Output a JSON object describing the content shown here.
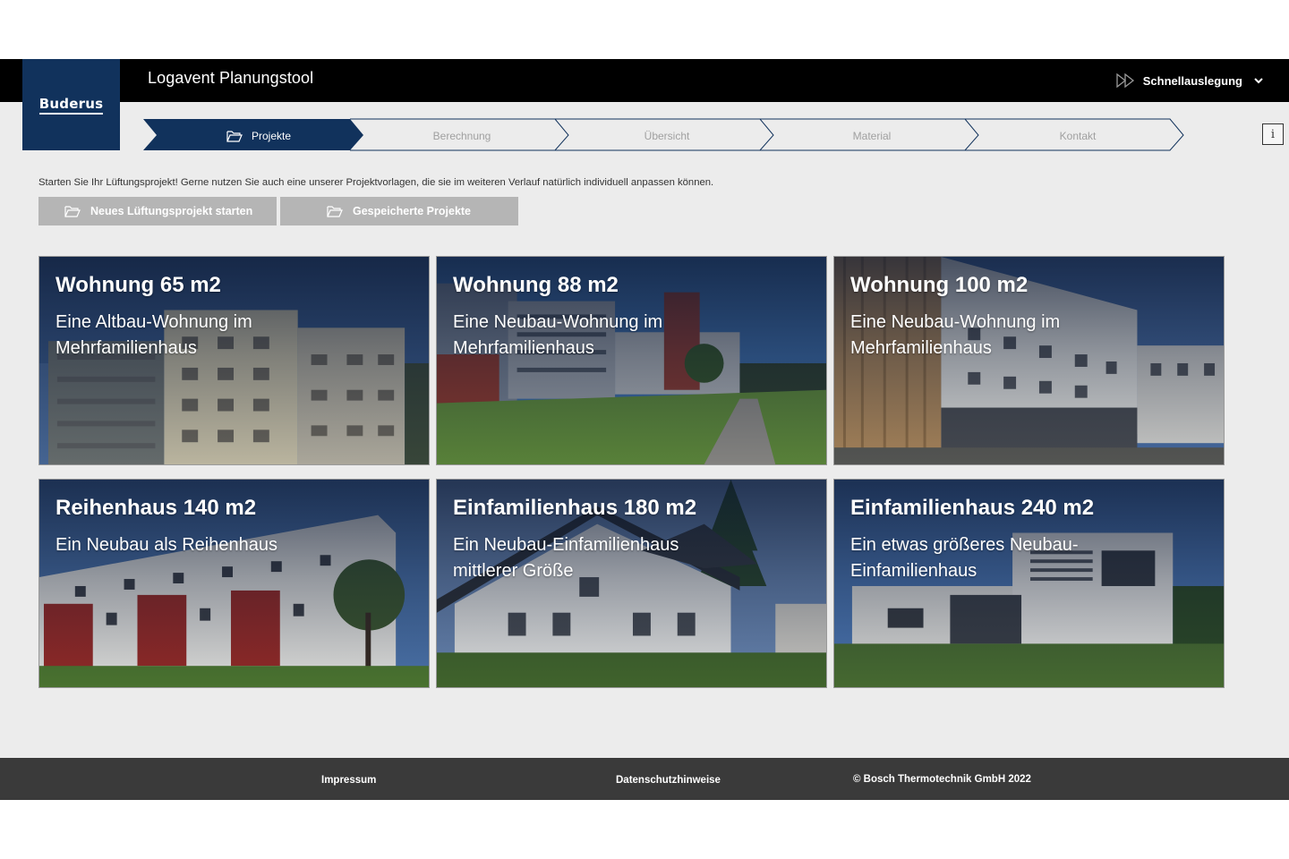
{
  "brand": {
    "logo_text": "Buderus",
    "primary": "#11325c"
  },
  "header": {
    "title": "Logavent Planungstool",
    "quick_design": "Schnellauslegung"
  },
  "steps": [
    {
      "label": "Projekte",
      "active": true
    },
    {
      "label": "Berechnung",
      "active": false
    },
    {
      "label": "Übersicht",
      "active": false
    },
    {
      "label": "Material",
      "active": false
    },
    {
      "label": "Kontakt",
      "active": false
    }
  ],
  "info_button": "i",
  "intro_text": "Starten Sie Ihr Lüftungsprojekt! Gerne nutzen Sie auch eine unserer Projektvorlagen, die sie im weiteren Verlauf natürlich individuell anpassen können.",
  "actions": {
    "new_project": "Neues Lüftungsprojekt starten",
    "saved_projects": "Gespeicherte Projekte"
  },
  "cards": [
    {
      "title": "Wohnung 65 m2",
      "subtitle": "Eine Altbau-Wohnung im Mehrfamilienhaus"
    },
    {
      "title": "Wohnung 88 m2",
      "subtitle": "Eine Neubau-Wohnung im Mehrfamilienhaus"
    },
    {
      "title": "Wohnung 100 m2",
      "subtitle": "Eine Neubau-Wohnung im Mehrfamilienhaus"
    },
    {
      "title": "Reihenhaus 140 m2",
      "subtitle": "Ein Neubau als Reihenhaus"
    },
    {
      "title": "Einfamilienhaus 180 m2",
      "subtitle": "Ein Neubau-Einfamilienhaus mittlerer Größe"
    },
    {
      "title": "Einfamilienhaus 240 m2",
      "subtitle": "Ein etwas größeres Neubau-Einfamilienhaus"
    }
  ],
  "footer": {
    "impressum": "Impressum",
    "privacy": "Datenschutzhinweise",
    "copyright": "© Bosch Thermotechnik GmbH 2022"
  }
}
